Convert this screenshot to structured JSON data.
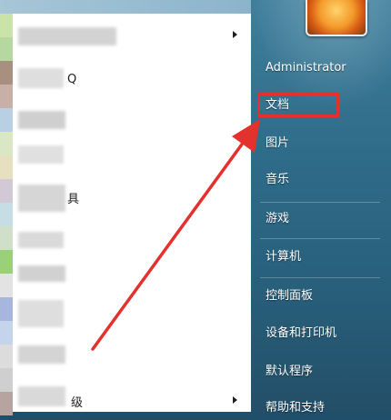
{
  "right_menu": {
    "user": "Administrator",
    "items": [
      {
        "label": "文档"
      },
      {
        "label": "图片"
      },
      {
        "label": "音乐"
      },
      {
        "label": "游戏"
      },
      {
        "label": "计算机"
      },
      {
        "label": "控制面板"
      },
      {
        "label": "设备和打印机"
      },
      {
        "label": "默认程序"
      },
      {
        "label": "帮助和支持"
      }
    ]
  },
  "left_menu": {
    "visible_text": [
      "Q",
      "具",
      "级"
    ]
  },
  "annotation": {
    "highlight_color": "#e3312e"
  }
}
